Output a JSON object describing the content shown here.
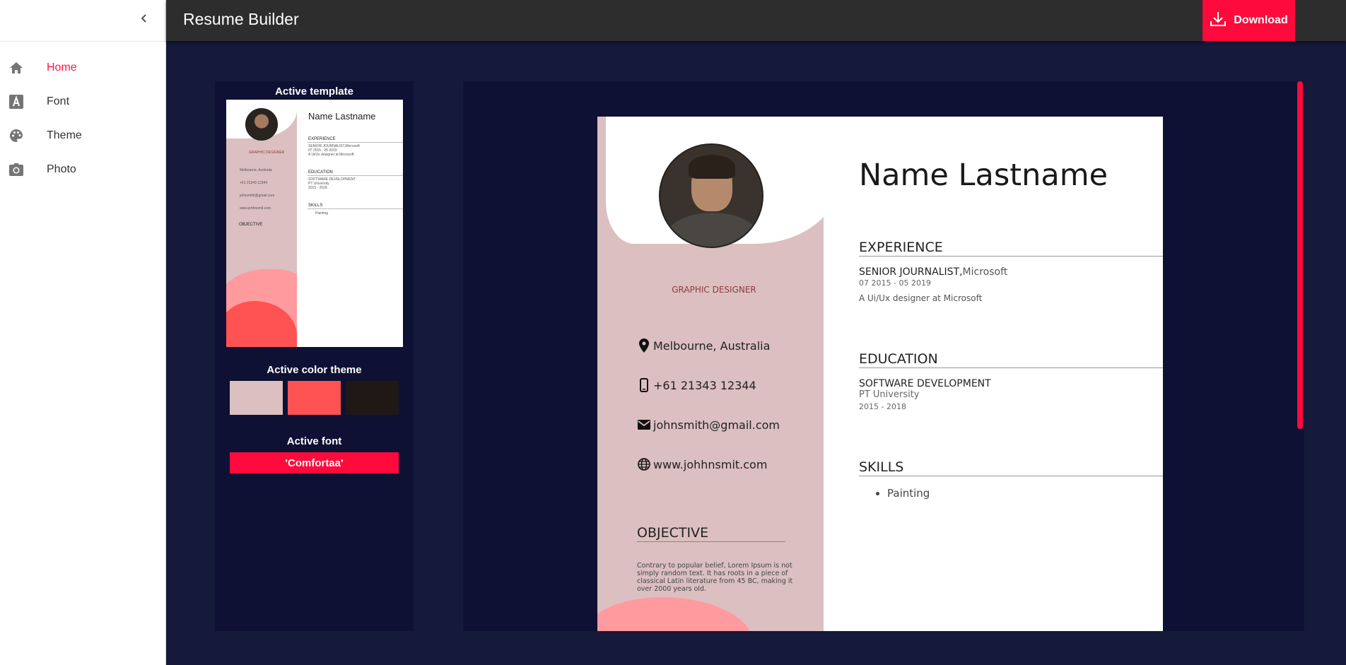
{
  "app": {
    "title": "Resume Builder",
    "download_label": "Download"
  },
  "sidebar": {
    "items": [
      {
        "label": "Home",
        "icon": "home-icon",
        "active": true
      },
      {
        "label": "Font",
        "icon": "font-icon",
        "active": false
      },
      {
        "label": "Theme",
        "icon": "palette-icon",
        "active": false
      },
      {
        "label": "Photo",
        "icon": "camera-icon",
        "active": false
      }
    ]
  },
  "left_panel": {
    "template_title": "Active template",
    "color_title": "Active color theme",
    "font_title": "Active font",
    "font_value": "'Comfortaa'",
    "colors": [
      "#dcbfc0",
      "#ff5252",
      "#1f1815"
    ]
  },
  "thumbnail": {
    "name": "Name Lastname",
    "role": "GRAPHIC DESIGNER",
    "experience": "EXPERIENCE",
    "exp_line": "SENIOR JOURNALIST,Microsoft",
    "exp_date": "07 2015 - 05 2019",
    "exp_desc": "A Ui/Ux designer at Microsoft",
    "education": "EDUCATION",
    "edu_line": "SOFTWARE DEVELOPMENT",
    "edu_school": "PT University",
    "edu_date": "2015 - 2018",
    "skills": "SKILLS",
    "skill1": "Painting",
    "location": "Melbourne, Australia",
    "phone": "+61 21343 12344",
    "email": "johnsmith@gmail.com",
    "web": "www.johhnsmit.com",
    "objective": "OBJECTIVE"
  },
  "resume": {
    "name": "Name Lastname",
    "role": "GRAPHIC DESIGNER",
    "location": "Melbourne, Australia",
    "phone": "+61 21343 12344",
    "email": "johnsmith@gmail.com",
    "website": "www.johhnsmit.com",
    "objective_title": "OBJECTIVE",
    "objective_text": "Contrary to popular belief, Lorem Ipsum is not simply random text. It has roots in a piece of classical Latin literature from 45 BC, making it over 2000 years old.",
    "experience_title": "EXPERIENCE",
    "exp_position": "SENIOR JOURNALIST,",
    "exp_company": "Microsoft",
    "exp_dates": "07 2015 - 05 2019",
    "exp_desc": "A Ui/Ux designer at Microsoft",
    "education_title": "EDUCATION",
    "edu_degree": "SOFTWARE DEVELOPMENT",
    "edu_school": "PT University",
    "edu_dates": "2015 - 2018",
    "skills_title": "SKILLS",
    "skills": [
      "Painting"
    ]
  }
}
